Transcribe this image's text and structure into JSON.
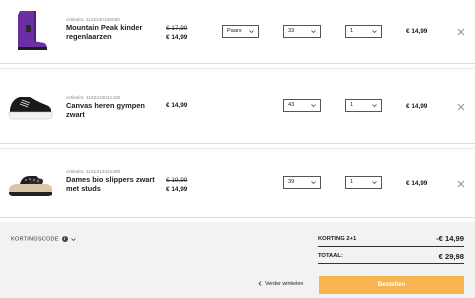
{
  "items": [
    {
      "article_number": "Artikelnr. 1115230106030",
      "name": "Mountain Peak kinder regenlaarzen",
      "old_price": "€ 17,99",
      "price": "€ 14,99",
      "color": "Paars",
      "size": "33",
      "quantity": "1",
      "total": "€ 14,99",
      "image": "purple-rain-boot"
    },
    {
      "article_number": "Artikelnr. 1162210041430",
      "name": "Canvas heren gympen zwart",
      "price": "€ 14,99",
      "size": "43",
      "quantity": "1",
      "total": "€ 14,99",
      "image": "black-canvas-sneaker"
    },
    {
      "article_number": "Artikelnr. 1161313441390",
      "name": "Dames bio slippers zwart met studs",
      "old_price": "€ 19,99",
      "price": "€ 14,99",
      "size": "39",
      "quantity": "1",
      "total": "€ 14,99",
      "image": "black-studded-slipper"
    }
  ],
  "coupon": {
    "label": "KORTINGSCODE"
  },
  "summary": {
    "discount_label": "KORTING 2+1",
    "discount_value": "-€ 14,99",
    "total_label": "TOTAAL:",
    "total_value": "€ 29,98"
  },
  "actions": {
    "continue_label": "Verder winkelen",
    "order_label": "Bestellen"
  },
  "colors": {
    "accent": "#f7b44f",
    "footer_bg": "#f2f2f2"
  },
  "icons": [
    "close-icon",
    "chevron-down-icon",
    "info-icon",
    "chevron-left-icon"
  ]
}
